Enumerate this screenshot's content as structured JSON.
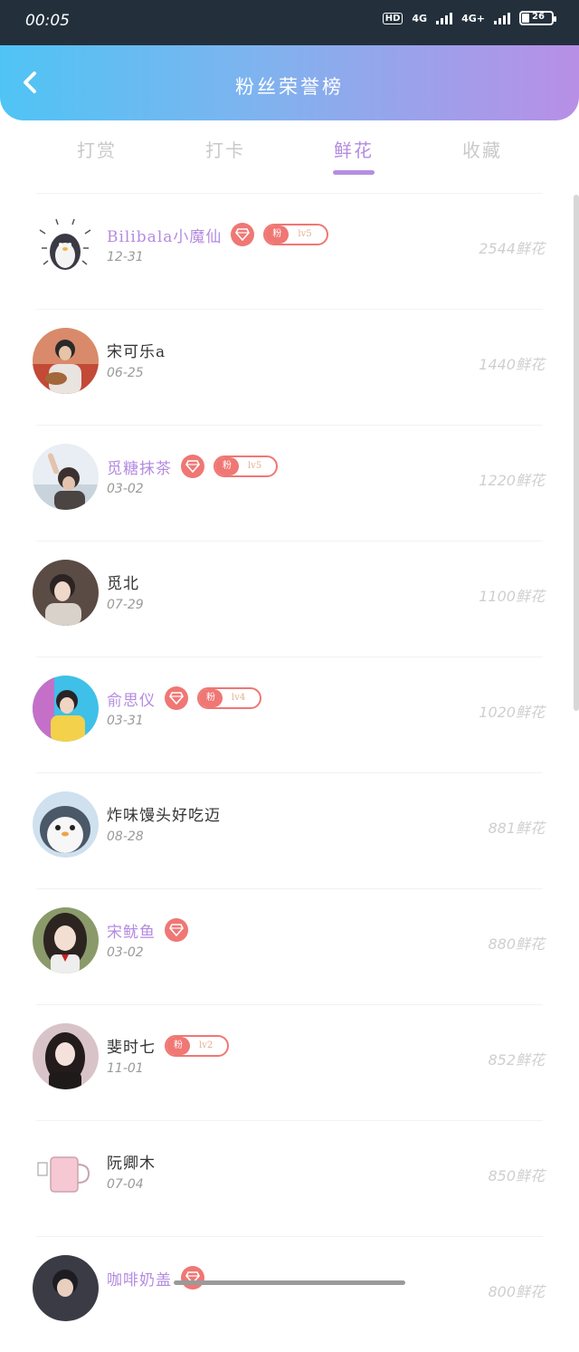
{
  "status_bar": {
    "time": "00:05",
    "hd": "HD",
    "net1": "4G",
    "net2": "4G+",
    "battery": "26"
  },
  "header": {
    "title": "粉丝荣誉榜",
    "back_icon": "chevron-left-icon"
  },
  "tabs": [
    {
      "label": "打赏",
      "active": false
    },
    {
      "label": "打卡",
      "active": false
    },
    {
      "label": "鲜花",
      "active": true
    },
    {
      "label": "收藏",
      "active": false
    }
  ],
  "fan_badge_label": "粉",
  "rows": [
    {
      "name": "Bilibala小魔仙",
      "date": "12-31",
      "flowers": "2544鲜花",
      "vip": true,
      "level": "lv5"
    },
    {
      "name": "宋可乐a",
      "date": "06-25",
      "flowers": "1440鲜花",
      "vip": false,
      "level": ""
    },
    {
      "name": "觅糖抹茶",
      "date": "03-02",
      "flowers": "1220鲜花",
      "vip": true,
      "level": "lv5"
    },
    {
      "name": "觅北",
      "date": "07-29",
      "flowers": "1100鲜花",
      "vip": false,
      "level": ""
    },
    {
      "name": "俞思仪",
      "date": "03-31",
      "flowers": "1020鲜花",
      "vip": true,
      "level": "lv4"
    },
    {
      "name": "炸味馒头好吃迈",
      "date": "08-28",
      "flowers": "881鲜花",
      "vip": false,
      "level": ""
    },
    {
      "name": "宋鱿鱼",
      "date": "03-02",
      "flowers": "880鲜花",
      "vip": true,
      "level": ""
    },
    {
      "name": "斐时七",
      "date": "11-01",
      "flowers": "852鲜花",
      "vip": false,
      "level": "lv2"
    },
    {
      "name": "阮卿木",
      "date": "07-04",
      "flowers": "850鲜花",
      "vip": false,
      "level": ""
    },
    {
      "name": "咖啡奶盖",
      "date": "",
      "flowers": "800鲜花",
      "vip": true,
      "level": ""
    }
  ],
  "colors": {
    "accent_purple": "#b48be0",
    "badge_red": "#ef7774",
    "header_gradient_start": "#4fc4f4",
    "header_gradient_end": "#b88fe6"
  }
}
